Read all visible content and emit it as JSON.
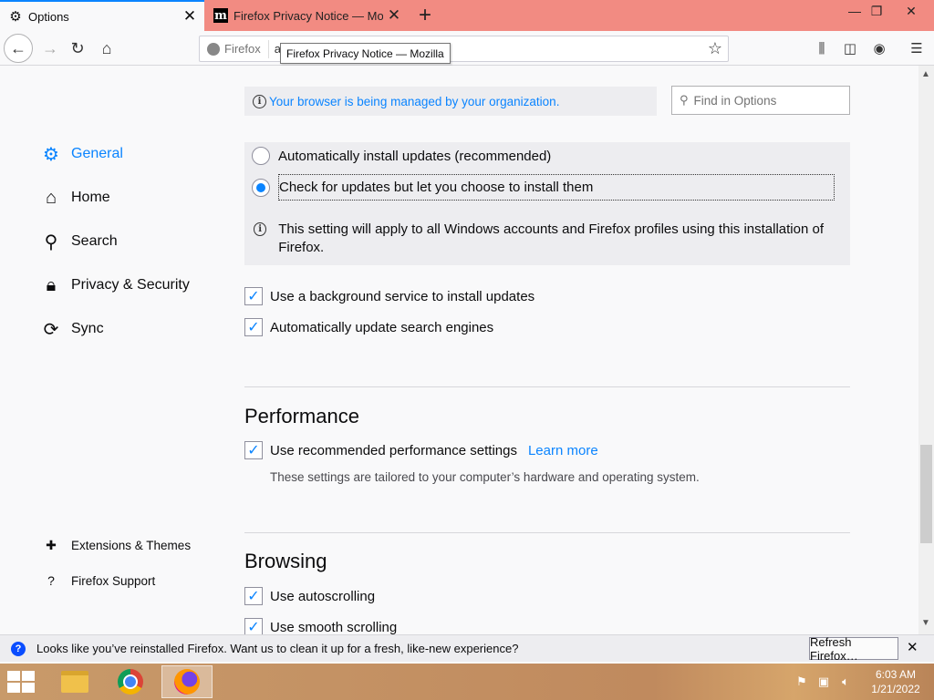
{
  "tabs": [
    {
      "title": "Options",
      "icon": "gear-icon"
    },
    {
      "title": "Firefox Privacy Notice — Mozill",
      "icon": "mozilla-m-icon"
    }
  ],
  "navbar": {
    "identity_label": "Firefox",
    "url_text": "a",
    "tooltip": "Firefox Privacy Notice — Mozilla"
  },
  "sidebar": {
    "categories": [
      {
        "label": "General",
        "icon": "gear-icon"
      },
      {
        "label": "Home",
        "icon": "home-icon"
      },
      {
        "label": "Search",
        "icon": "search-icon"
      },
      {
        "label": "Privacy & Security",
        "icon": "lock-icon"
      },
      {
        "label": "Sync",
        "icon": "sync-icon"
      }
    ],
    "footer": [
      {
        "label": "Extensions & Themes",
        "icon": "puzzle-icon"
      },
      {
        "label": "Firefox Support",
        "icon": "help-icon"
      }
    ]
  },
  "main": {
    "managed_notice": "Your browser is being managed by your organization.",
    "find_placeholder": "Find in Options",
    "updates": {
      "radio_auto": "Automatically install updates (recommended)",
      "radio_check": "Check for updates but let you choose to install them",
      "selected": "check",
      "note": "This setting will apply to all Windows accounts and Firefox profiles using this installation of Firefox."
    },
    "checkboxes_updates": [
      {
        "label": "Use a background service to install updates",
        "checked": true
      },
      {
        "label": "Automatically update search engines",
        "checked": true
      }
    ],
    "performance": {
      "title": "Performance",
      "checkbox_label": "Use recommended performance settings",
      "learn_more": "Learn more",
      "description": "These settings are tailored to your computer’s hardware and operating system."
    },
    "browsing": {
      "title": "Browsing",
      "checkboxes": [
        {
          "label": "Use autoscrolling",
          "checked": true
        },
        {
          "label": "Use smooth scrolling",
          "checked": true
        }
      ]
    }
  },
  "notification": {
    "message": "Looks like you’ve reinstalled Firefox. Want us to clean it up for a fresh, like-new experience?",
    "button": "Refresh Firefox…"
  },
  "taskbar": {
    "time": "6:03 AM",
    "date": "1/21/2022"
  },
  "colors": {
    "accent": "#0a84ff",
    "tabstrip": "#f28b82"
  }
}
